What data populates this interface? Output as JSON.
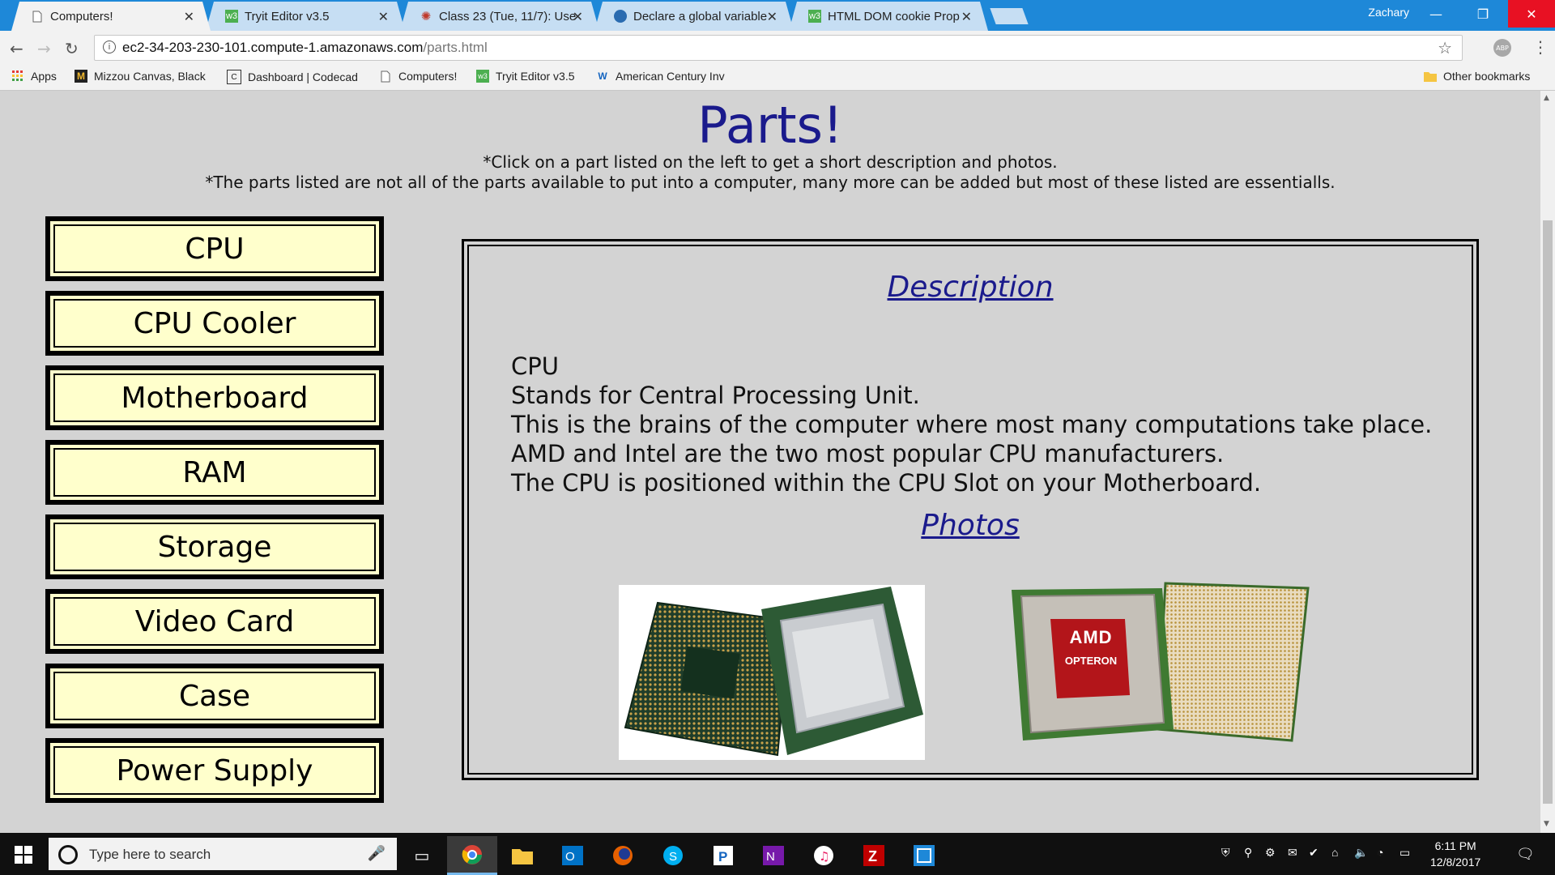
{
  "browser": {
    "tabs": [
      {
        "title": "Computers!",
        "favicon": "page-icon",
        "active": true
      },
      {
        "title": "Tryit Editor v3.5",
        "favicon": "w3schools-icon",
        "active": false
      },
      {
        "title": "Class 23 (Tue, 11/7): Use",
        "favicon": "gear-red-icon",
        "active": false
      },
      {
        "title": "Declare a global variable",
        "favicon": "globe-icon",
        "active": false
      },
      {
        "title": "HTML DOM cookie Prop",
        "favicon": "w3schools-icon",
        "active": false
      }
    ],
    "user_name": "Zachary",
    "url_host": "ec2-34-203-230-101.compute-1.amazonaws.com",
    "url_path": "/parts.html",
    "abp_label": "ABP",
    "bookmarks": [
      {
        "label": "Apps",
        "icon": "apps-grid-icon"
      },
      {
        "label": "Mizzou Canvas, Black",
        "icon": "mizzou-icon"
      },
      {
        "label": "Dashboard | Codecad",
        "icon": "codecademy-icon"
      },
      {
        "label": "Computers!",
        "icon": "page-icon"
      },
      {
        "label": "Tryit Editor v3.5",
        "icon": "w3schools-icon"
      },
      {
        "label": "American Century Inv",
        "icon": "american-century-icon"
      }
    ],
    "other_bookmarks": "Other bookmarks"
  },
  "page": {
    "title": "Parts!",
    "note1": "*Click on a part listed on the left to get a short description and photos.",
    "note2": "*The parts listed are not all of the parts available to put into a computer, many more can be added but most of these listed are essentialls.",
    "parts": [
      "CPU",
      "CPU Cooler",
      "Motherboard",
      "RAM",
      "Storage",
      "Video Card",
      "Case",
      "Power Supply"
    ],
    "description_heading": "Description",
    "description_lines": [
      "CPU",
      "Stands for Central Processing Unit.",
      "This is the brains of the computer where most many computations take place.",
      "AMD and Intel are the two most popular CPU manufacturers.",
      "The CPU is positioned within the CPU Slot on your Motherboard."
    ],
    "photos_heading": "Photos",
    "photo2_brand": "AMD",
    "photo2_model": "OPTERON"
  },
  "taskbar": {
    "search_placeholder": "Type here to search",
    "time": "6:11 PM",
    "date": "12/8/2017"
  },
  "colors": {
    "page_bg": "#d3d3d3",
    "title_blue": "#1a1a8c",
    "button_bg": "#ffffcc",
    "chrome_blue": "#1e88d8"
  }
}
